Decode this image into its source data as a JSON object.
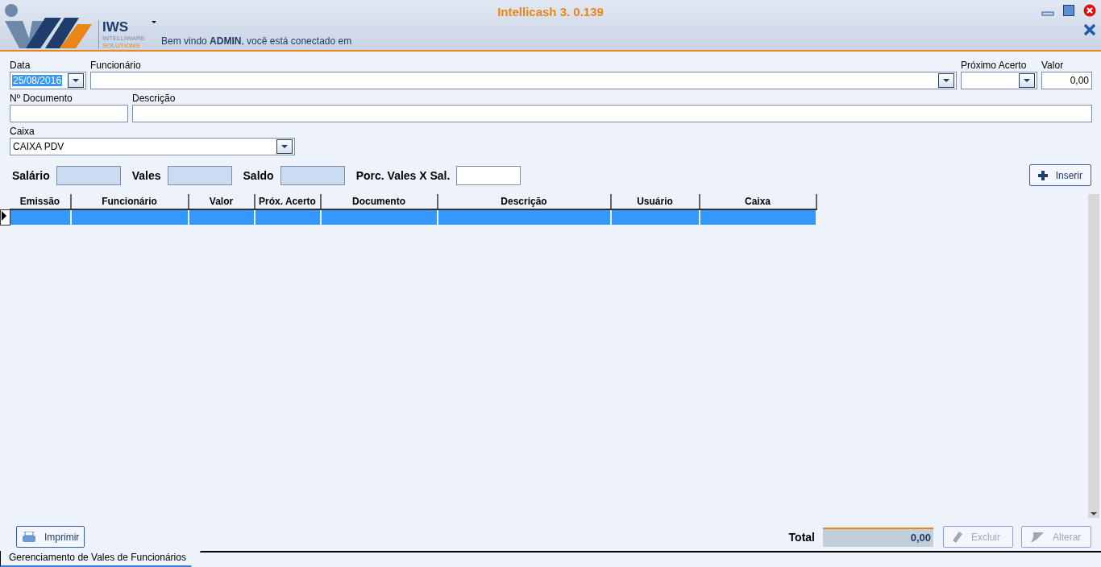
{
  "header": {
    "title": "Intellicash 3. 0.139",
    "logo_text": "IWS",
    "logo_sub_1": "INTELLIWARE",
    "logo_sub_2": "SOLUTIONS",
    "welcome": "Bem vindo **ADMIN**, você está conectado em"
  },
  "form": {
    "row1": [
      {
        "label": "Data",
        "kind": "combo",
        "value": "25/08/2016",
        "highlighted": true
      },
      {
        "label": "Funcionário",
        "kind": "combo"
      },
      {
        "label": "Próximo Acerto",
        "kind": "combo"
      },
      {
        "label": "Valor",
        "kind": "text",
        "value": "0,00"
      }
    ],
    "row2": [
      {
        "label": "Nº Documento",
        "kind": "text"
      },
      {
        "label": "Descrição",
        "kind": "text"
      }
    ],
    "row3": [
      {
        "label": "Caixa",
        "kind": "combo",
        "value": "CAIXA PDV"
      }
    ]
  },
  "summary": {
    "fields": [
      {
        "label": "Salário",
        "kind": "readonly"
      },
      {
        "label": "Vales",
        "kind": "readonly"
      },
      {
        "label": "Saldo",
        "kind": "readonly"
      },
      {
        "label": "Porc. Vales X Sal.",
        "kind": "input"
      }
    ],
    "insert_button": "Inserir"
  },
  "table": {
    "columns": [
      "Emissão",
      "Funcionário",
      "Valor",
      "Próx. Acerto",
      "Documento",
      "Descrição",
      "Usuário",
      "Caixa"
    ],
    "rows": [
      {
        "selected": true
      }
    ]
  },
  "footer": {
    "print_button": "Imprimir",
    "total_label": "Total",
    "total_value": "0,00",
    "buttons": [
      {
        "label": "Excluir",
        "kind": "delete",
        "disabled": true
      },
      {
        "label": "Alterar",
        "kind": "edit",
        "disabled": true
      }
    ]
  },
  "tabs": [
    {
      "label": "Gerenciamento de Vales de Funcionários",
      "selected": true
    }
  ]
}
